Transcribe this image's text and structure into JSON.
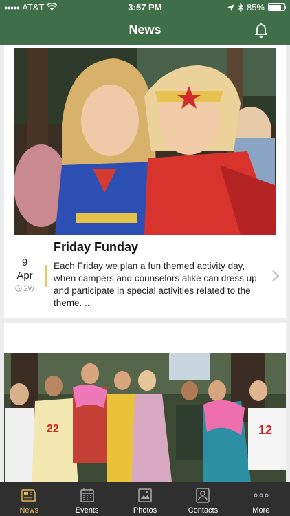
{
  "status_bar": {
    "carrier": "AT&T",
    "time": "3:57 PM",
    "battery": "85%",
    "battery_level": 0.85
  },
  "header": {
    "title": "News",
    "notification_icon": "bell-icon"
  },
  "posts": [
    {
      "title": "Friday Funday",
      "day": "9",
      "month": "Apr",
      "ago": "2w",
      "excerpt": "Each Friday we plan a fun themed activity day, when campers and counselors alike can dress up and participate in special activities related to the theme. ..."
    }
  ],
  "tabs": [
    {
      "label": "News",
      "icon": "newspaper-icon",
      "active": true
    },
    {
      "label": "Events",
      "icon": "calendar-icon",
      "active": false
    },
    {
      "label": "Photos",
      "icon": "photo-icon",
      "active": false
    },
    {
      "label": "Contacts",
      "icon": "contact-icon",
      "active": false
    },
    {
      "label": "More",
      "icon": "more-icon",
      "active": false
    }
  ],
  "colors": {
    "header_green": "#3f6f48",
    "tab_bar": "#2f2f2f",
    "accent": "#e3b95a"
  }
}
